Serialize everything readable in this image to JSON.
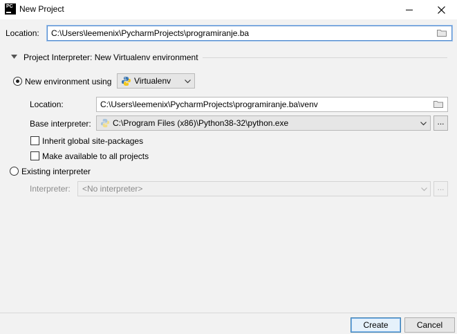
{
  "window": {
    "app_icon_text": "PC",
    "title": "New Project"
  },
  "location": {
    "label": "Location:",
    "value": "C:\\Users\\leemenix\\PycharmProjects\\programiranje.ba"
  },
  "interpreter_section": {
    "header": "Project Interpreter: New Virtualenv environment",
    "new_env": {
      "label": "New environment using",
      "tool": "Virtualenv",
      "location_label": "Location:",
      "location_value": "C:\\Users\\leemenix\\PycharmProjects\\programiranje.ba\\venv",
      "base_label": "Base interpreter:",
      "base_value": "C:\\Program Files (x86)\\Python38-32\\python.exe",
      "browse_label": "...",
      "inherit_label": "Inherit global site-packages",
      "make_available_label": "Make available to all projects"
    },
    "existing": {
      "label": "Existing interpreter",
      "interpreter_label": "Interpreter:",
      "interpreter_value": "<No interpreter>",
      "browse_label": "..."
    }
  },
  "buttons": {
    "create": "Create",
    "cancel": "Cancel"
  },
  "colors": {
    "focus_border": "#5a8fcf",
    "primary_button_border": "#3c7fb1"
  }
}
